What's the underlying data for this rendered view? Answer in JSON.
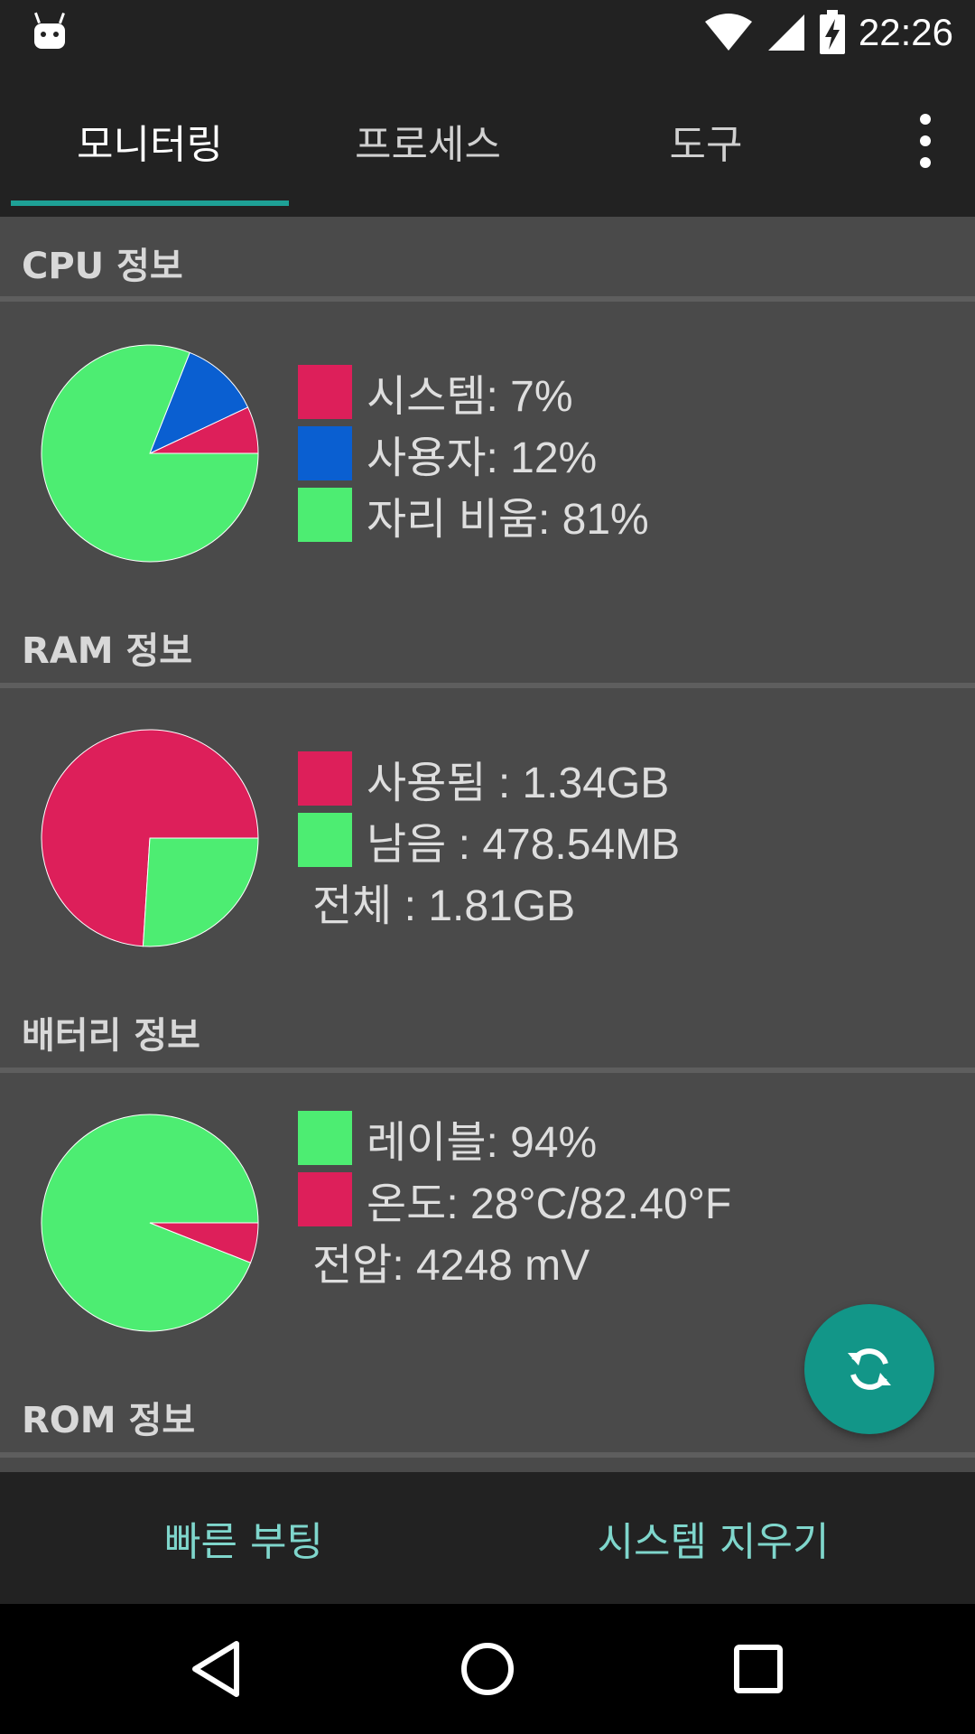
{
  "status_bar": {
    "time": "22:26",
    "icons": [
      "android-debug-icon",
      "wifi-icon",
      "signal-icon",
      "battery-charging-icon"
    ]
  },
  "tabs": [
    {
      "label": "모니터링",
      "active": true
    },
    {
      "label": "프로세스",
      "active": false
    },
    {
      "label": "도구",
      "active": false
    }
  ],
  "sections": {
    "cpu": {
      "title": "CPU 정보",
      "legend": [
        {
          "label": "시스템: 7%",
          "color": "#dd1f5a"
        },
        {
          "label": "사용자: 12%",
          "color": "#0a5fd1"
        },
        {
          "label": "자리 비움: 81%",
          "color": "#4ded72"
        }
      ],
      "pie": [
        {
          "name": "시스템",
          "value": 7,
          "color": "#dd1f5a"
        },
        {
          "name": "사용자",
          "value": 12,
          "color": "#0a5fd1"
        },
        {
          "name": "자리 비움",
          "value": 81,
          "color": "#4ded72"
        }
      ]
    },
    "ram": {
      "title": "RAM 정보",
      "legend": [
        {
          "label": "사용됨 : 1.34GB",
          "color": "#dd1f5a"
        },
        {
          "label": "남음 : 478.54MB",
          "color": "#4ded72"
        }
      ],
      "total": "전체 : 1.81GB",
      "pie": [
        {
          "name": "사용됨",
          "value": 74,
          "color": "#dd1f5a"
        },
        {
          "name": "남음",
          "value": 26,
          "color": "#4ded72"
        }
      ]
    },
    "battery": {
      "title": "배터리 정보",
      "legend": [
        {
          "label": "레이블: 94%",
          "color": "#4ded72"
        },
        {
          "label": "온도: 28°C/82.40°F",
          "color": "#dd1f5a"
        }
      ],
      "voltage": "전압: 4248 mV",
      "pie": [
        {
          "name": "레이블",
          "value": 94,
          "color": "#4ded72"
        },
        {
          "name": "온도",
          "value": 6,
          "color": "#dd1f5a"
        }
      ]
    },
    "rom": {
      "title": "ROM 정보"
    }
  },
  "fab": {
    "icon": "refresh-icon",
    "color": "#129688"
  },
  "bottom_actions": [
    "빠른 부팅",
    "시스템 지우기"
  ],
  "nav": {
    "icons": [
      "back-icon",
      "home-icon",
      "recents-icon"
    ]
  },
  "colors": {
    "accent": "#1ea196",
    "background": "#4a4a4a",
    "bar": "#222222",
    "red": "#dd1f5a",
    "green": "#4ded72",
    "blue": "#0a5fd1"
  }
}
